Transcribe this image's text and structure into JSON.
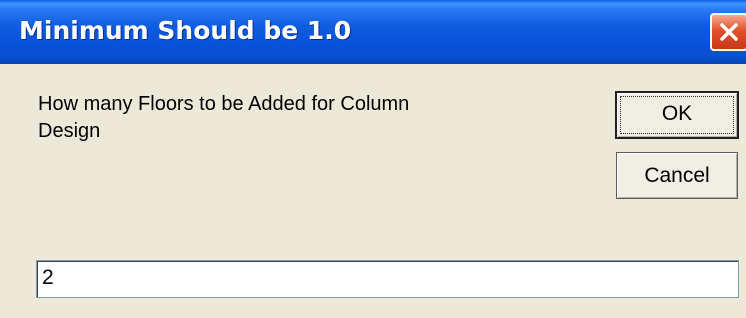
{
  "window": {
    "title": "Minimum Should be 1.0",
    "close_icon": "close-icon"
  },
  "dialog": {
    "prompt_line1": "How many Floors to be Added for Column",
    "prompt_line2": "Design",
    "ok_label": "OK",
    "cancel_label": "Cancel",
    "input_value": "2"
  },
  "colors": {
    "titlebar": "#0A50D0",
    "dialog_bg": "#ECE9D8",
    "close_button": "#E3512C"
  }
}
